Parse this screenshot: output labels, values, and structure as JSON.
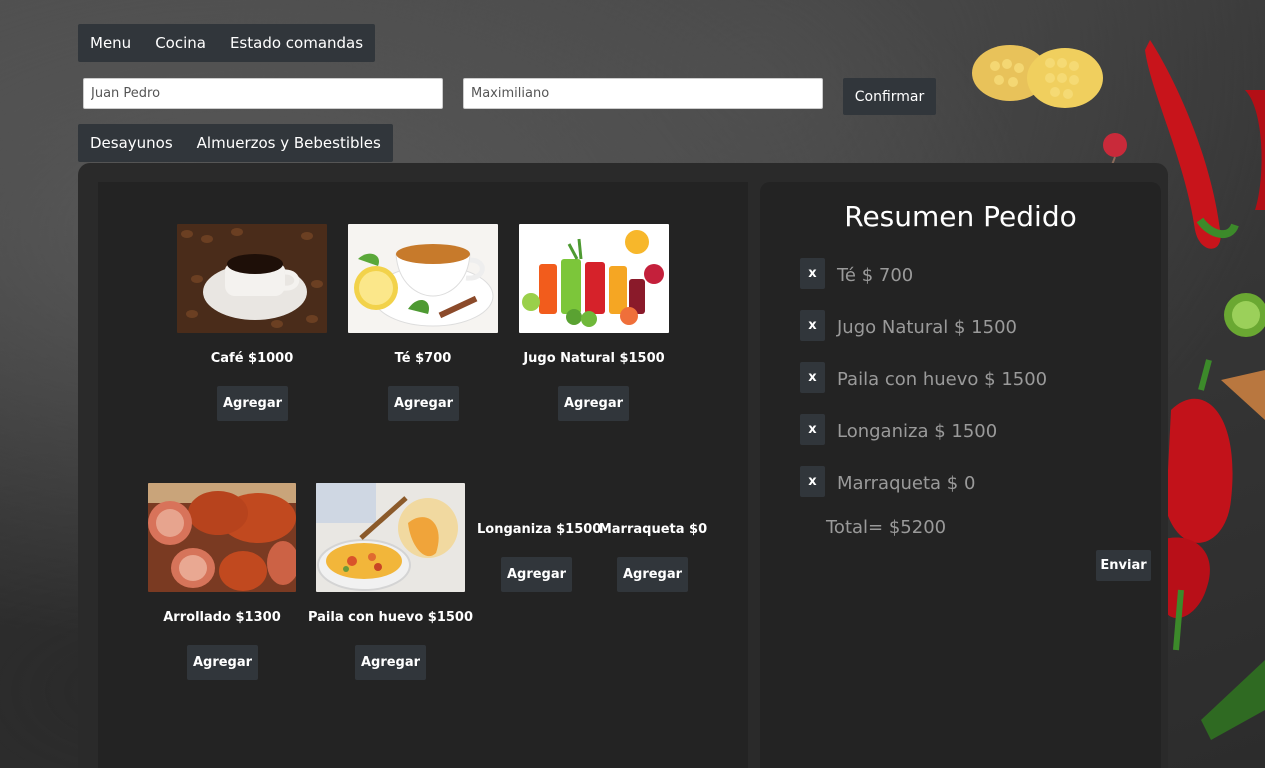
{
  "nav": {
    "items": [
      {
        "label": "Menu"
      },
      {
        "label": "Cocina"
      },
      {
        "label": "Estado comandas"
      }
    ]
  },
  "form": {
    "first_name_value": "Juan Pedro",
    "second_name_value": "Maximiliano",
    "confirm_label": "Confirmar"
  },
  "categories": [
    {
      "label": "Desayunos"
    },
    {
      "label": "Almuerzos y Bebestibles"
    }
  ],
  "products": [
    {
      "name": "Café $1000",
      "image": "coffee-cup-image",
      "add_label": "Agregar"
    },
    {
      "name": "Té $700",
      "image": "tea-cup-image",
      "add_label": "Agregar"
    },
    {
      "name": "Jugo Natural $1500",
      "image": "fruit-juices-image",
      "add_label": "Agregar"
    },
    {
      "name": "Arrollado $1300",
      "image": "arrollado-meat-image",
      "add_label": "Agregar"
    },
    {
      "name": "Paila con huevo $1500",
      "image": "paila-con-huevo-image",
      "add_label": "Agregar"
    },
    {
      "name": "Longaniza $1500",
      "add_label": "Agregar"
    },
    {
      "name": "Marraqueta $0",
      "add_label": "Agregar"
    }
  ],
  "summary": {
    "title": "Resumen Pedido",
    "remove_label": "x",
    "items": [
      {
        "text": "Té $ 700"
      },
      {
        "text": "Jugo Natural $ 1500"
      },
      {
        "text": "Paila con huevo $ 1500"
      },
      {
        "text": "Longaniza $ 1500"
      },
      {
        "text": "Marraqueta $ 0"
      }
    ],
    "total": "Total= $5200",
    "send_label": "Enviar"
  },
  "colors": {
    "button_bg": "#31363b",
    "panel_bg": "#232323",
    "muted_text": "#9a9a9a"
  }
}
